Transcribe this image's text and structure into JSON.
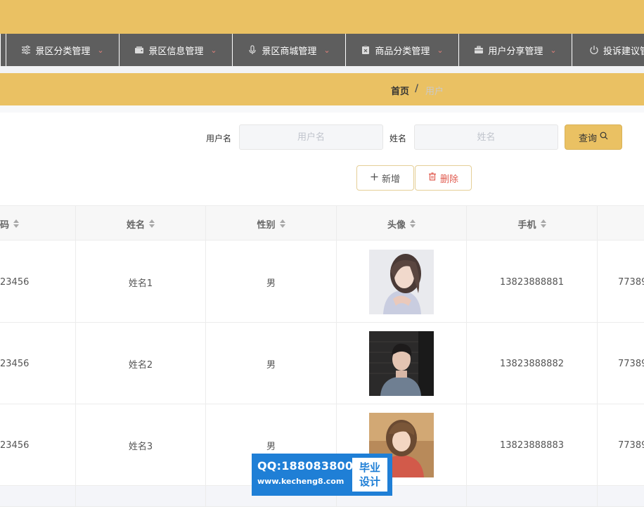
{
  "nav": {
    "items": [
      {
        "label": "景区分类管理",
        "icon": "sliders-icon"
      },
      {
        "label": "景区信息管理",
        "icon": "wallet-icon"
      },
      {
        "label": "景区商城管理",
        "icon": "microphone-icon"
      },
      {
        "label": "商品分类管理",
        "icon": "clipboard-icon"
      },
      {
        "label": "用户分享管理",
        "icon": "briefcase-icon"
      },
      {
        "label": "投诉建议管",
        "icon": "power-icon"
      }
    ]
  },
  "breadcrumb": {
    "home": "首页",
    "separator": "/",
    "current": "用户"
  },
  "search": {
    "username_label": "用户名",
    "username_placeholder": "用户名",
    "name_label": "姓名",
    "name_placeholder": "姓名",
    "query_label": "查询"
  },
  "actions": {
    "add_label": "新增",
    "delete_label": "删除"
  },
  "table": {
    "headers": [
      "密码",
      "姓名",
      "性别",
      "头像",
      "手机",
      ""
    ],
    "header_partial": "码",
    "rows": [
      {
        "password": "23456",
        "name": "姓名1",
        "gender": "男",
        "phone": "13823888881",
        "extra": "77389"
      },
      {
        "password": "23456",
        "name": "姓名2",
        "gender": "男",
        "phone": "13823888882",
        "extra": "77389"
      },
      {
        "password": "23456",
        "name": "姓名3",
        "gender": "男",
        "phone": "13823888883",
        "extra": "77389"
      }
    ]
  },
  "watermark": {
    "qq": "QQ:188083800",
    "url": "www.kecheng8.com",
    "tag_line1": "毕业",
    "tag_line2": "设计"
  },
  "colors": {
    "accent": "#eac163",
    "nav_bg": "#5e5e5e",
    "danger": "#e05a4e",
    "watermark": "#1f7fd6"
  }
}
